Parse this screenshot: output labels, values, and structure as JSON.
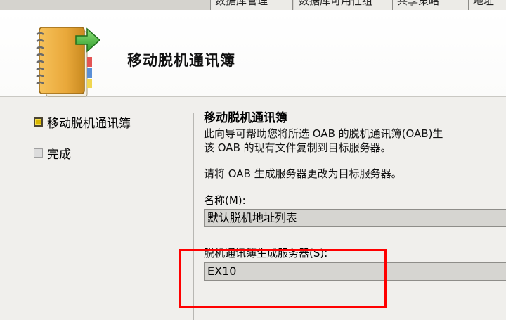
{
  "background_tabs": [
    "数据库管理",
    "数据库可用性组",
    "共享策略",
    "地址"
  ],
  "wizard": {
    "title": "移动脱机通讯簿",
    "steps": [
      {
        "label": "移动脱机通讯簿",
        "active": true
      },
      {
        "label": "完成",
        "active": false
      }
    ],
    "page": {
      "title": "移动脱机通讯簿",
      "description_line1": "此向导可帮助您将所选 OAB 的脱机通讯簿(OAB)生",
      "description_line2": "该 OAB 的现有文件复制到目标服务器。",
      "instruction": "请将 OAB 生成服务器更改为目标服务器。",
      "name_label": "名称(M):",
      "name_value": "默认脱机地址列表",
      "server_label": "脱机通讯簿生成服务器(S):",
      "server_value": "EX10"
    }
  },
  "colors": {
    "highlight": "#ff0000",
    "active_step": "#d8b600"
  },
  "icons": {
    "header": "address-book-with-arrow-icon"
  }
}
